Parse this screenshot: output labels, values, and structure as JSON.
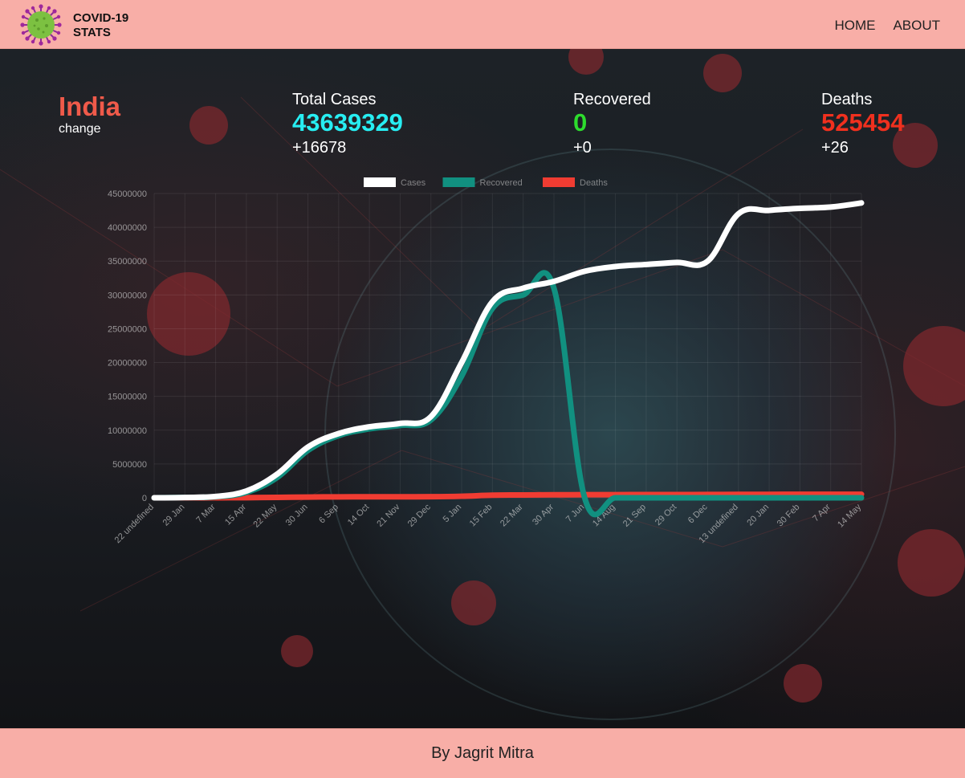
{
  "navbar": {
    "brand_line1": "COVID-19",
    "brand_line2": "STATS",
    "links": [
      "HOME",
      "ABOUT"
    ]
  },
  "country": {
    "name": "India",
    "change_label": "change"
  },
  "stats": {
    "total_cases": {
      "label": "Total Cases",
      "value": "43639329",
      "delta": "+16678",
      "color": "#27eef2"
    },
    "recovered": {
      "label": "Recovered",
      "value": "0",
      "delta": "+0",
      "color": "#2ddc2d"
    },
    "deaths": {
      "label": "Deaths",
      "value": "525454",
      "delta": "+26",
      "color": "#f0301e"
    }
  },
  "footer": {
    "text": "By Jagrit Mitra"
  },
  "chart_data": {
    "type": "line",
    "x": [
      "22 undefined",
      "29 Jan",
      "7 Mar",
      "15 Apr",
      "22 May",
      "30 Jun",
      "6 Sep",
      "14 Oct",
      "21 Nov",
      "29 Dec",
      "5 Jan",
      "15 Feb",
      "22 Mar",
      "30 Apr",
      "7 Jun",
      "14 Aug",
      "21 Sep",
      "29 Oct",
      "6 Dec",
      "13 undefined",
      "20 Jan",
      "30 Feb",
      "7 Apr",
      "14 May"
    ],
    "ylim": [
      0,
      45000000
    ],
    "yticks": [
      "0",
      "5000000",
      "10000000",
      "15000000",
      "20000000",
      "25000000",
      "30000000",
      "35000000",
      "40000000",
      "45000000"
    ],
    "grid": true,
    "legend_position": "top",
    "series": [
      {
        "name": "Cases",
        "color": "#ffffff",
        "values": [
          0,
          50000,
          200000,
          1000000,
          3500000,
          7500000,
          9500000,
          10500000,
          11000000,
          12000000,
          20000000,
          29000000,
          31000000,
          32000000,
          33500000,
          34200000,
          34500000,
          34800000,
          35000000,
          42000000,
          42500000,
          42800000,
          43000000,
          43600000
        ]
      },
      {
        "name": "Recovered",
        "color": "#119080",
        "values": [
          0,
          40000,
          150000,
          800000,
          3000000,
          7000000,
          9200000,
          10200000,
          10700000,
          11500000,
          18000000,
          28000000,
          30000000,
          31000000,
          0,
          0,
          0,
          0,
          0,
          0,
          0,
          0,
          0,
          0
        ]
      },
      {
        "name": "Deaths",
        "color": "#f03c32",
        "values": [
          0,
          1000,
          5000,
          20000,
          60000,
          110000,
          140000,
          150000,
          155000,
          160000,
          230000,
          380000,
          420000,
          440000,
          455000,
          465000,
          475000,
          480000,
          485000,
          500000,
          510000,
          515000,
          520000,
          525000
        ]
      }
    ]
  }
}
